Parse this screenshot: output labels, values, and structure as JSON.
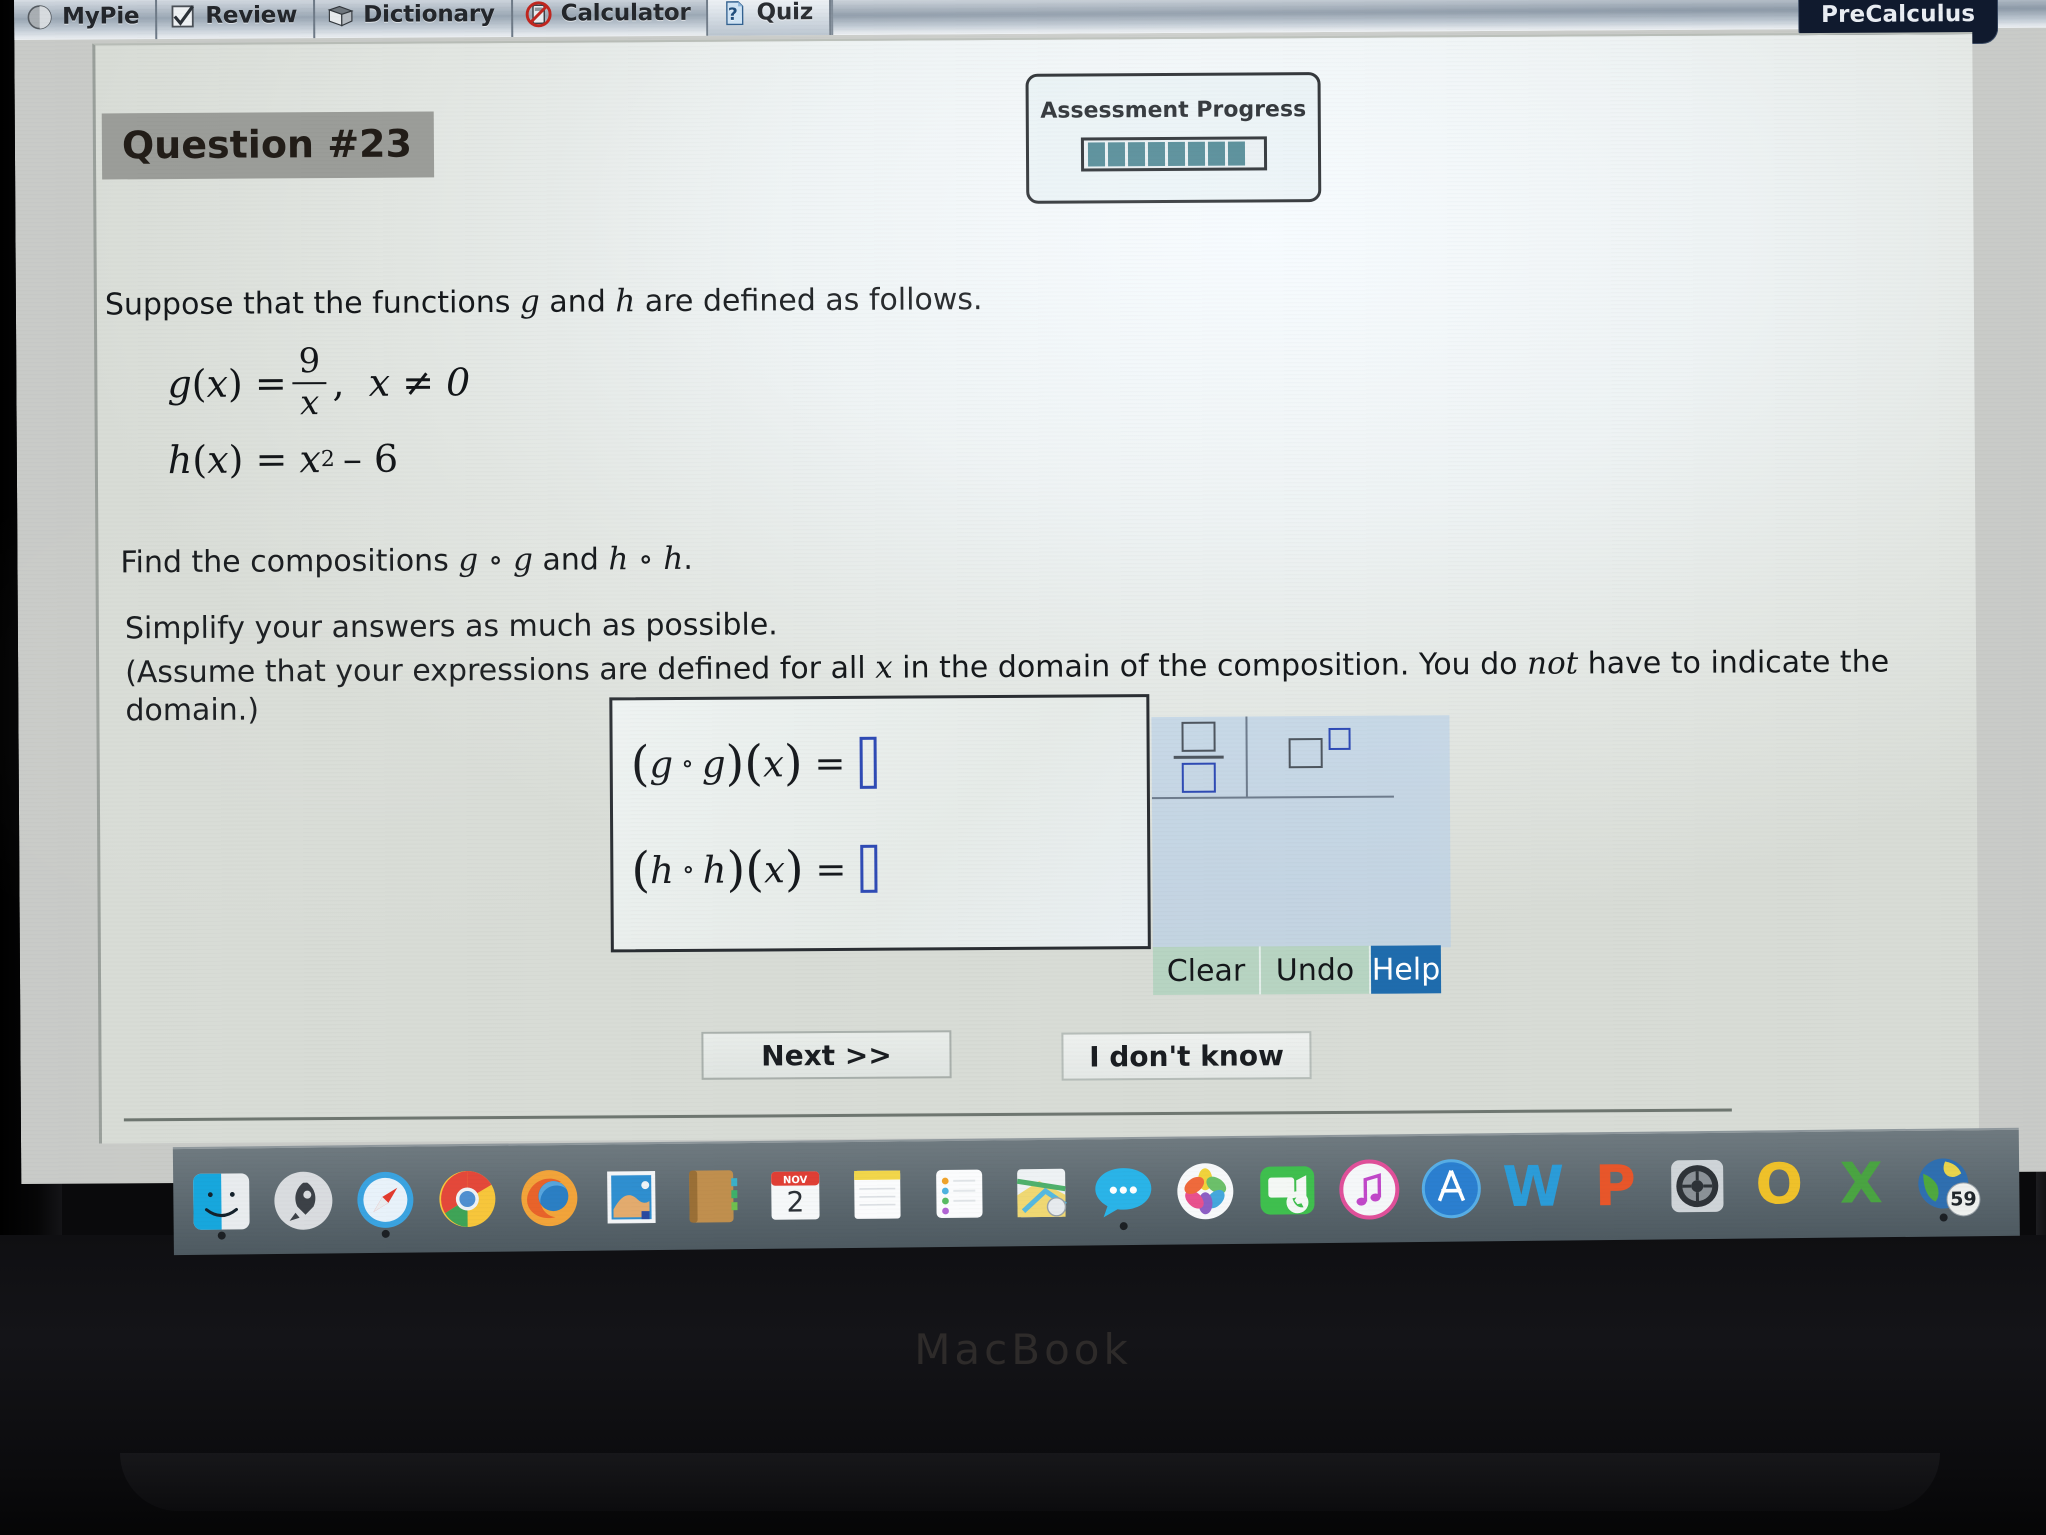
{
  "window": {
    "course_badge": "PreCalculus",
    "tabs": [
      {
        "label": "MyPie",
        "icon": "mypie-icon",
        "active": false
      },
      {
        "label": "Review",
        "icon": "checkmark-icon",
        "active": false
      },
      {
        "label": "Dictionary",
        "icon": "book-icon",
        "active": false
      },
      {
        "label": "Calculator",
        "icon": "no-calculator-icon",
        "active": false
      },
      {
        "label": "Quiz",
        "icon": "quiz-page-icon",
        "active": true
      }
    ]
  },
  "question": {
    "badge": "Question #23",
    "intro": "Suppose that the functions g and h are defined as follows.",
    "intro_parts": {
      "before_g": "Suppose that the functions ",
      "g": "g",
      "mid": " and ",
      "h": "h",
      "after": " are defined as follows."
    },
    "equations": [
      {
        "lhs_fn": "g",
        "lhs_var": "x",
        "numerator": "9",
        "denominator": "x",
        "condition": "x ≠ 0",
        "type": "fraction"
      },
      {
        "lhs_fn": "h",
        "lhs_var": "x",
        "base": "x",
        "exponent": "2",
        "constant": "– 6",
        "type": "polynomial"
      }
    ],
    "find_line": {
      "prefix": "Find the compositions ",
      "comp1": "g ∘ g",
      "middle": " and ",
      "comp2": "h ∘ h",
      "suffix": "."
    },
    "simplify_line": "Simplify your answers as much as possible.",
    "assume_line": {
      "part1": "(Assume that your expressions are defined for all ",
      "var": "x",
      "part2": " in the domain of the composition. You do ",
      "emphasis": "not",
      "part3": " have to indicate the domain.)"
    }
  },
  "progress": {
    "title": "Assessment Progress",
    "segments_filled": 8,
    "segments_total": 8,
    "fill_color": "#46828f"
  },
  "answers": [
    {
      "label_fn": "g",
      "label_op": "∘",
      "label_var": "x",
      "value": "",
      "placeholder": ""
    },
    {
      "label_fn": "h",
      "label_op": "∘",
      "label_var": "x",
      "value": "",
      "placeholder": ""
    }
  ],
  "math_palette": {
    "fraction_tool": "fraction-template-icon",
    "exponent_tool": "exponent-template-icon",
    "buttons": [
      {
        "label": "Clear",
        "name": "clear-button",
        "color": "#b7d4c2"
      },
      {
        "label": "Undo",
        "name": "undo-button",
        "color": "#b7d4c2"
      },
      {
        "label": "Help",
        "name": "help-button",
        "color": "#1f6cad"
      }
    ]
  },
  "actions": {
    "next": "Next >>",
    "dont_know": "I don't know"
  },
  "dock": {
    "items": [
      {
        "name": "finder",
        "icon": "finder-icon",
        "running": true
      },
      {
        "name": "launchpad",
        "icon": "launchpad-icon",
        "running": false
      },
      {
        "name": "safari",
        "icon": "safari-compass-icon",
        "running": true
      },
      {
        "name": "chrome",
        "icon": "chrome-icon",
        "running": false
      },
      {
        "name": "firefox",
        "icon": "firefox-icon",
        "running": false
      },
      {
        "name": "mail",
        "icon": "mail-stamp-icon",
        "running": false
      },
      {
        "name": "contacts",
        "icon": "contacts-book-icon",
        "running": false
      },
      {
        "name": "calendar",
        "icon": "calendar-icon",
        "running": false,
        "month": "NOV",
        "day": "2"
      },
      {
        "name": "notes",
        "icon": "notes-icon",
        "running": false
      },
      {
        "name": "reminders",
        "icon": "reminders-icon",
        "running": false
      },
      {
        "name": "maps",
        "icon": "maps-icon",
        "running": false
      },
      {
        "name": "messages",
        "icon": "messages-bubble-icon",
        "running": true
      },
      {
        "name": "photos",
        "icon": "photos-pinwheel-icon",
        "running": false
      },
      {
        "name": "facetime",
        "icon": "facetime-icon",
        "running": false
      },
      {
        "name": "itunes",
        "icon": "itunes-note-icon",
        "running": false
      },
      {
        "name": "app-store",
        "icon": "app-store-icon",
        "running": false
      },
      {
        "name": "word",
        "icon": "word-icon",
        "running": false,
        "letter": "W",
        "color": "#2b9cd8"
      },
      {
        "name": "powerpoint",
        "icon": "powerpoint-icon",
        "running": false,
        "letter": "P",
        "color": "#e8562a"
      },
      {
        "name": "system-preferences",
        "icon": "system-preferences-icon",
        "running": false
      },
      {
        "name": "outlook",
        "icon": "outlook-icon",
        "running": false,
        "letter": "O",
        "color": "#efc12a"
      },
      {
        "name": "excel",
        "icon": "excel-icon",
        "running": false,
        "letter": "X",
        "color": "#4aa442"
      },
      {
        "name": "world-clock",
        "icon": "globe-icon",
        "running": true,
        "badge": "59"
      }
    ]
  },
  "hardware": {
    "brand": "MacBook"
  }
}
